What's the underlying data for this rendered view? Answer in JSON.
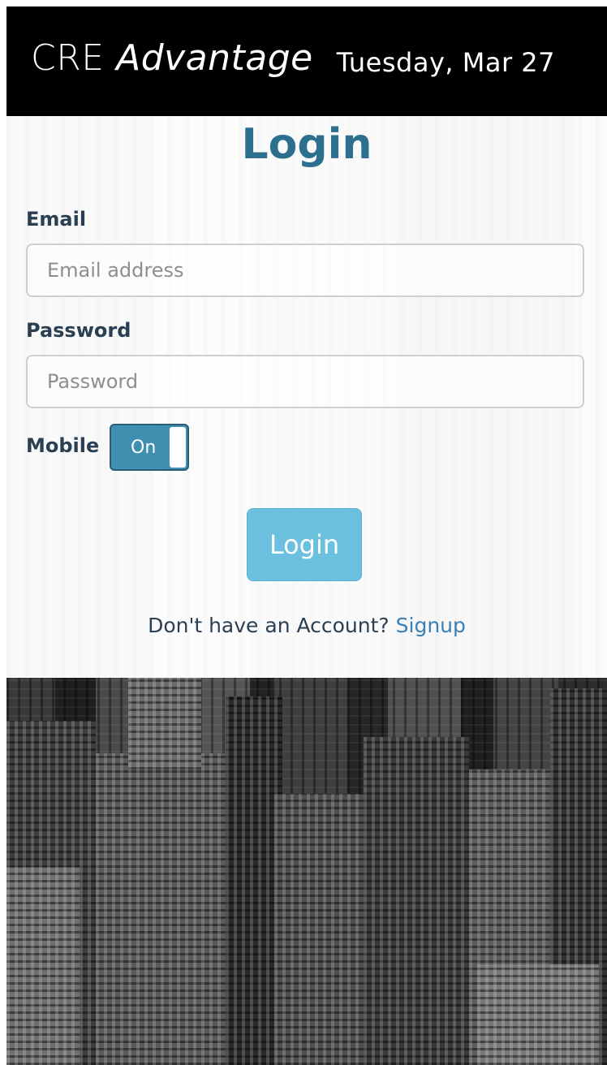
{
  "header": {
    "brand_regular": "CRE",
    "brand_italic": "Advantage",
    "date": "Tuesday, Mar 27"
  },
  "login": {
    "title": "Login",
    "email_label": "Email",
    "email_placeholder": "Email address",
    "password_label": "Password",
    "password_placeholder": "Password",
    "mobile_label": "Mobile",
    "mobile_toggle_state": "On",
    "submit_label": "Login",
    "signup_prompt": "Don't have an Account?",
    "signup_link": "Signup"
  },
  "colors": {
    "header_bg": "#000000",
    "title": "#2d6f8f",
    "toggle_bg": "#3f8fb0",
    "button_bg": "#6bbfdf",
    "link": "#3a7fb5"
  }
}
